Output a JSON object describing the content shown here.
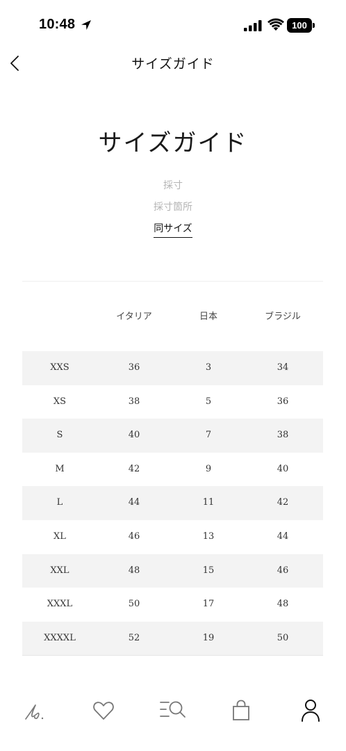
{
  "status_bar": {
    "time": "10:48",
    "battery": "100"
  },
  "nav": {
    "title": "サイズガイド"
  },
  "page": {
    "title": "サイズガイド"
  },
  "sub_tabs": [
    {
      "label": "採寸",
      "active": false
    },
    {
      "label": "採寸箇所",
      "active": false
    },
    {
      "label": "同サイズ",
      "active": true
    }
  ],
  "table": {
    "headers": [
      "",
      "イタリア",
      "日本",
      "ブラジル"
    ],
    "rows": [
      [
        "XXS",
        "36",
        "3",
        "34"
      ],
      [
        "XS",
        "38",
        "5",
        "36"
      ],
      [
        "S",
        "40",
        "7",
        "38"
      ],
      [
        "M",
        "42",
        "9",
        "40"
      ],
      [
        "L",
        "44",
        "11",
        "42"
      ],
      [
        "XL",
        "46",
        "13",
        "44"
      ],
      [
        "XXL",
        "48",
        "15",
        "46"
      ],
      [
        "XXXL",
        "50",
        "17",
        "48"
      ],
      [
        "XXXXL",
        "52",
        "19",
        "50"
      ]
    ]
  },
  "tab_bar": {
    "items": [
      {
        "icon": "home-signature-icon"
      },
      {
        "icon": "heart-icon"
      },
      {
        "icon": "search-menu-icon"
      },
      {
        "icon": "shopping-bag-icon"
      },
      {
        "icon": "account-icon"
      }
    ]
  },
  "colors": {
    "stripe": "#f3f3f3",
    "inactive_tab": "#b5b5b5",
    "text": "#222222"
  }
}
